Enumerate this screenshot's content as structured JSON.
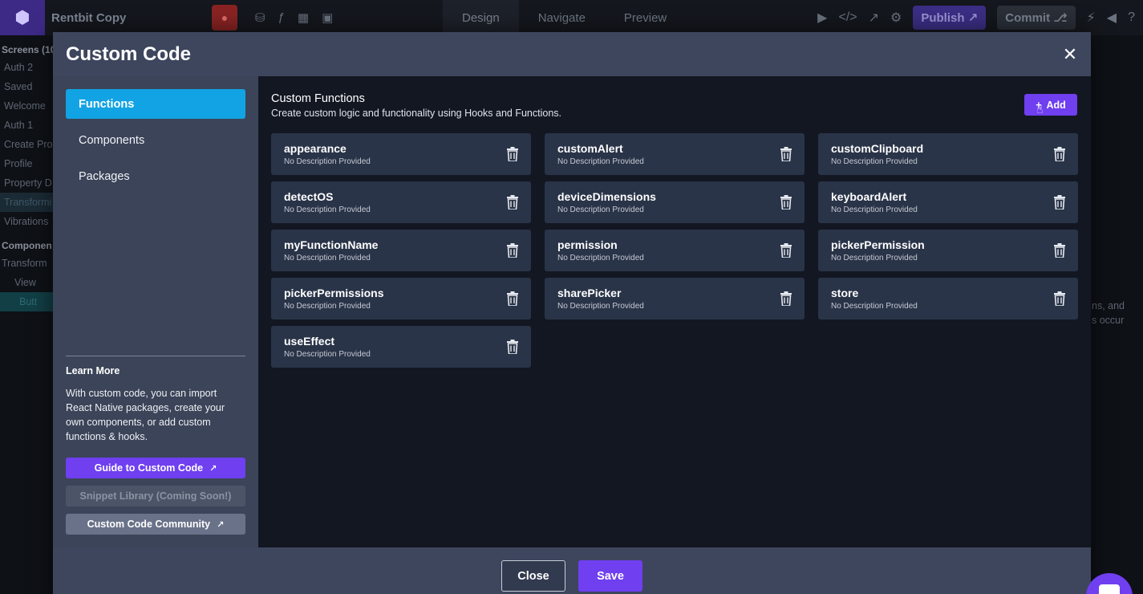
{
  "app": {
    "title": "Rentbit Copy",
    "tabs": [
      "Design",
      "Navigate",
      "Preview"
    ],
    "publish_label": "Publish",
    "commit_label": "Commit"
  },
  "left_panel": {
    "screens_header": "Screens (10",
    "screens": [
      "Auth 2",
      "Saved",
      "Welcome",
      "Auth 1",
      "Create Pro",
      "Profile",
      "Property D",
      "Transformi",
      "Vibrations"
    ],
    "components_header": "Componen",
    "tree": [
      "Transform",
      "View",
      "Butt"
    ]
  },
  "right_panel": {
    "text_line1": "ns, and",
    "text_line2": "s occur"
  },
  "modal": {
    "title": "Custom Code",
    "close_icon": "close-icon",
    "nav": [
      "Functions",
      "Components",
      "Packages"
    ],
    "learn_more": {
      "title": "Learn More",
      "body": "With custom code, you can import React Native packages, create your own components, or add custom functions & hooks.",
      "guide_label": "Guide to Custom Code",
      "snippet_label": "Snippet Library (Coming Soon!)",
      "community_label": "Custom Code Community"
    },
    "content": {
      "title": "Custom Functions",
      "subtitle": "Create custom logic and functionality using Hooks and Functions.",
      "add_label": "Add",
      "functions": [
        {
          "name": "appearance",
          "desc": "No Description Provided"
        },
        {
          "name": "customAlert",
          "desc": "No Description Provided"
        },
        {
          "name": "customClipboard",
          "desc": "No Description Provided"
        },
        {
          "name": "detectOS",
          "desc": "No Description Provided"
        },
        {
          "name": "deviceDimensions",
          "desc": "No Description Provided"
        },
        {
          "name": "keyboardAlert",
          "desc": "No Description Provided"
        },
        {
          "name": "myFunctionName",
          "desc": "No Description Provided"
        },
        {
          "name": "permission",
          "desc": "No Description Provided"
        },
        {
          "name": "pickerPermission",
          "desc": "No Description Provided"
        },
        {
          "name": "pickerPermissions",
          "desc": "No Description Provided"
        },
        {
          "name": "sharePicker",
          "desc": "No Description Provided"
        },
        {
          "name": "store",
          "desc": "No Description Provided"
        },
        {
          "name": "useEffect",
          "desc": "No Description Provided"
        }
      ]
    },
    "footer": {
      "close_label": "Close",
      "save_label": "Save"
    }
  },
  "colors": {
    "accent": "#6f3ff0",
    "active_tab": "#12a3e4",
    "modal_header": "#3d465d",
    "card": "#2a3448"
  }
}
